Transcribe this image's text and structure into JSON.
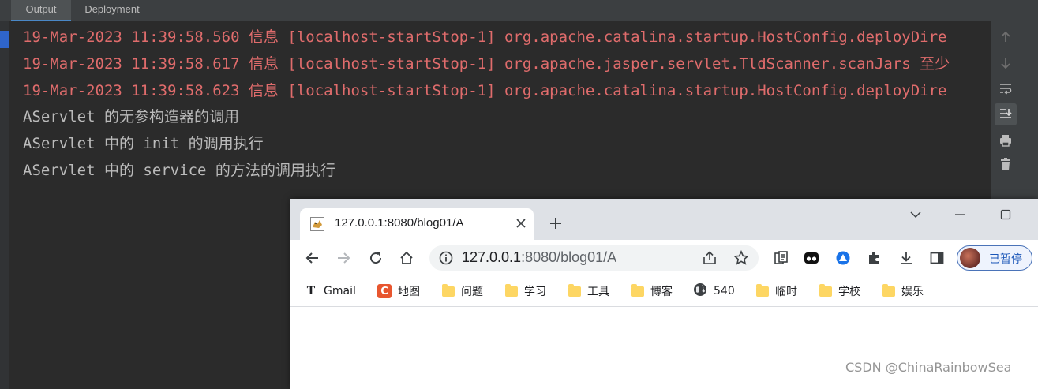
{
  "ide": {
    "tabs": [
      "Output",
      "Deployment"
    ],
    "log_lines": [
      {
        "text": "19-Mar-2023 11:39:58.560 信息 [localhost-startStop-1] org.apache.catalina.startup.HostConfig.deployDire",
        "style": "red"
      },
      {
        "text": "19-Mar-2023 11:39:58.617 信息 [localhost-startStop-1] org.apache.jasper.servlet.TldScanner.scanJars 至少",
        "style": "red"
      },
      {
        "text": "19-Mar-2023 11:39:58.623 信息 [localhost-startStop-1] org.apache.catalina.startup.HostConfig.deployDire",
        "style": "red"
      },
      {
        "text": "AServlet 的无参构造器的调用",
        "style": "plain"
      },
      {
        "text": "AServlet 中的 init 的调用执行",
        "style": "plain"
      },
      {
        "text": "AServlet 中的 service 的方法的调用执行",
        "style": "plain"
      }
    ],
    "toolbar_icons": [
      "arrow-up-icon",
      "arrow-down-icon",
      "soft-wrap-icon",
      "scroll-to-end-icon",
      "print-icon",
      "trash-icon"
    ],
    "colors": {
      "log_red": "#e06c6c",
      "log_plain": "#bbbbbb",
      "background": "#2b2b2b"
    }
  },
  "browser": {
    "tab_title": "127.0.0.1:8080/blog01/A",
    "url_host": "127.0.0.1",
    "url_rest": ":8080/blog01/A",
    "profile_label": "已暂停",
    "bookmarks": [
      {
        "label": "Gmail",
        "icon": "gmail-icon"
      },
      {
        "label": "地图",
        "icon": "maps-icon"
      },
      {
        "label": "问题",
        "icon": "folder-icon"
      },
      {
        "label": "学习",
        "icon": "folder-icon"
      },
      {
        "label": "工具",
        "icon": "folder-icon"
      },
      {
        "label": "博客",
        "icon": "folder-icon"
      },
      {
        "label": "540",
        "icon": "globe-icon"
      },
      {
        "label": "临时",
        "icon": "folder-icon"
      },
      {
        "label": "学校",
        "icon": "folder-icon"
      },
      {
        "label": "娱乐",
        "icon": "folder-icon"
      }
    ]
  },
  "watermark": "CSDN @ChinaRainbowSea"
}
